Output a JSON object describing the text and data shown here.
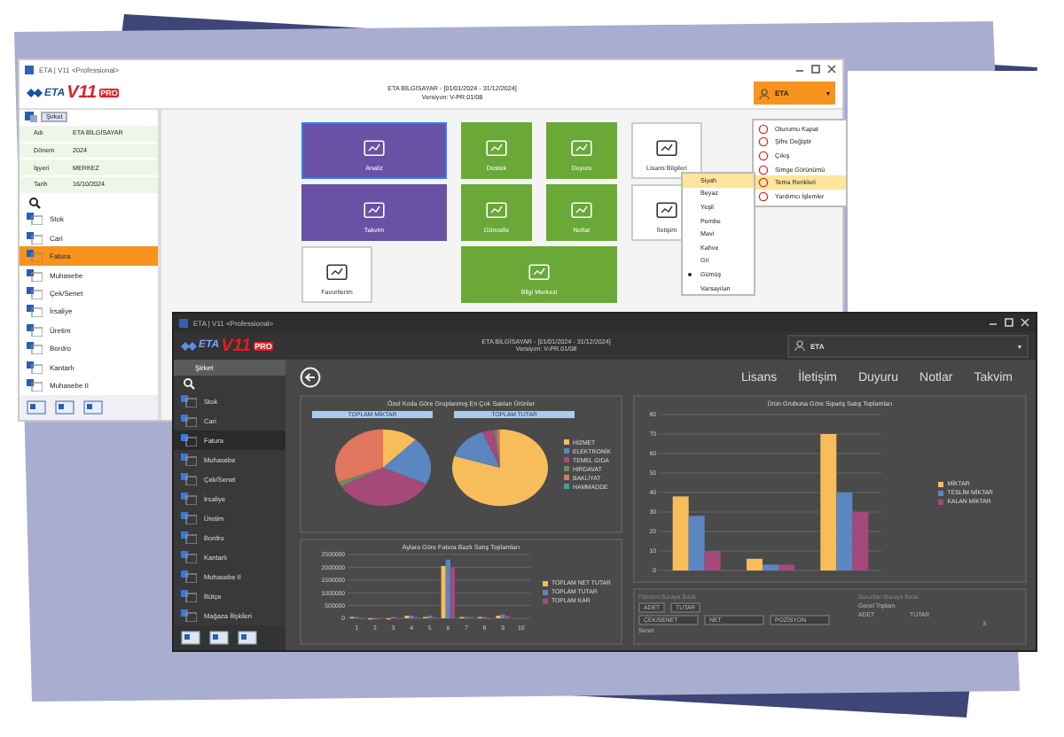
{
  "light_window": {
    "title": "ETA | V11 <Professional>",
    "logo": {
      "brand": "ETA",
      "version": "V11",
      "badge": "PRO"
    },
    "header": {
      "company": "ETA BİLGİSAYAR - [01/01/2024 - 31/12/2024]",
      "version": "Versiyon: V-PR.01/08"
    },
    "user": {
      "name": "ETA",
      "caret": "▾"
    },
    "company_node": "Şirket",
    "fields": [
      {
        "label": "Adı",
        "value": "ETA BİLGİSAYAR"
      },
      {
        "label": "Dönem",
        "value": "2024"
      },
      {
        "label": "İşyeri",
        "value": "MERKEZ"
      },
      {
        "label": "Tarih",
        "value": "16/10/2024"
      }
    ],
    "modules": [
      {
        "label": "Stok",
        "selected": false
      },
      {
        "label": "Cari",
        "selected": false
      },
      {
        "label": "Fatura",
        "selected": true
      },
      {
        "label": "Muhasebe",
        "selected": false
      },
      {
        "label": "Çek/Senet",
        "selected": false
      },
      {
        "label": "İrsaliye",
        "selected": false
      },
      {
        "label": "Üretim",
        "selected": false
      },
      {
        "label": "Bordro",
        "selected": false
      },
      {
        "label": "Kantarlı",
        "selected": false
      },
      {
        "label": "Muhasebe II",
        "selected": false
      }
    ],
    "tiles": [
      {
        "label": "Analiz",
        "kind": "primary",
        "selected": true
      },
      {
        "label": "Destek",
        "kind": "secondary",
        "selected": false
      },
      {
        "label": "Duyuru",
        "kind": "secondary",
        "selected": false
      },
      {
        "label": "Lisans Bilgileri",
        "kind": "plain",
        "selected": false
      },
      {
        "label": "Takvim",
        "kind": "primary",
        "selected": false
      },
      {
        "label": "Güncelle",
        "kind": "secondary",
        "selected": false
      },
      {
        "label": "Notlar",
        "kind": "secondary",
        "selected": false
      },
      {
        "label": "İletişim",
        "kind": "plain",
        "selected": false
      },
      {
        "label": "Favorilerim",
        "kind": "plain",
        "selected": false
      },
      {
        "label": "Bilgi Merkezi",
        "kind": "secondary",
        "selected": false
      }
    ],
    "user_menu": [
      {
        "label": "Oturumu Kapat",
        "selected": false
      },
      {
        "label": "Şifre Değiştir",
        "selected": false
      },
      {
        "label": "Çıkış",
        "selected": false
      },
      {
        "label": "Simge Görünümü",
        "selected": false
      },
      {
        "label": "Tema Renkleri",
        "selected": true
      },
      {
        "label": "Yardımcı İşlemler",
        "selected": false
      }
    ],
    "theme_menu": [
      {
        "label": "Siyah",
        "selected": true,
        "checked": false
      },
      {
        "label": "Beyaz",
        "selected": false,
        "checked": false
      },
      {
        "label": "Yeşil",
        "selected": false,
        "checked": false
      },
      {
        "label": "Pembe",
        "selected": false,
        "checked": false
      },
      {
        "label": "Mavi",
        "selected": false,
        "checked": false
      },
      {
        "label": "Kahve",
        "selected": false,
        "checked": false
      },
      {
        "label": "Gri",
        "selected": false,
        "checked": false
      },
      {
        "label": "Gümüş",
        "selected": false,
        "checked": true
      },
      {
        "label": "Varsayılan",
        "selected": false,
        "checked": false
      }
    ]
  },
  "dark_window": {
    "title": "ETA | V11 <Professional>",
    "logo": {
      "brand": "ETA",
      "version": "V11",
      "badge": "PRO"
    },
    "header": {
      "company": "ETA BİLGİSAYAR - [01/01/2024 - 31/12/2024]",
      "version": "Versiyon: V-PR.01/08"
    },
    "user": {
      "name": "ETA",
      "caret": "▾"
    },
    "company_node": "Şirket",
    "modules": [
      {
        "label": "Stok",
        "selected": false
      },
      {
        "label": "Cari",
        "selected": false
      },
      {
        "label": "Fatura",
        "selected": true
      },
      {
        "label": "Muhasebe",
        "selected": false
      },
      {
        "label": "Çek/Senet",
        "selected": false
      },
      {
        "label": "İrsaliye",
        "selected": false
      },
      {
        "label": "Üretim",
        "selected": false
      },
      {
        "label": "Bordro",
        "selected": false
      },
      {
        "label": "Kantarlı",
        "selected": false
      },
      {
        "label": "Muhasebe II",
        "selected": false
      },
      {
        "label": "Bütçe",
        "selected": false
      },
      {
        "label": "Mağaza İlişkileri",
        "selected": false
      }
    ],
    "nav": [
      "Lisans",
      "İletişim",
      "Duyuru",
      "Notlar",
      "Takvim"
    ],
    "pie_panel": {
      "title": "Özel Koda Göre Gruplanmış En Çok Satılan Ürünler",
      "tabs": [
        "TOPLAM MİKTAR",
        "TOPLAM TUTAR"
      ],
      "legend": [
        {
          "label": "HİZMET",
          "color": "#f7bd5a"
        },
        {
          "label": "ELEKTRONİK",
          "color": "#5a86c2"
        },
        {
          "label": "TEMEL GIDA",
          "color": "#a4497a"
        },
        {
          "label": "HIRDAVAT",
          "color": "#6f8a5c"
        },
        {
          "label": "BAKLİYAT",
          "color": "#e0775e"
        },
        {
          "label": "HAMMADDE",
          "color": "#3aa59a"
        }
      ]
    },
    "order_chart": {
      "chart_data": {
        "type": "bar",
        "title": "Ürün Grubuna Göre Sipariş Satış Toplamları",
        "grid": true,
        "legend": "right",
        "ylim": [
          0,
          80
        ],
        "yticks": [
          0,
          10,
          20,
          30,
          40,
          50,
          60,
          70,
          80
        ],
        "series": [
          {
            "name": "MİKTAR",
            "color": "#f7bd5a",
            "values": [
              38,
              6,
              70
            ]
          },
          {
            "name": "TESLİM MİKTAR",
            "color": "#5a86c2",
            "values": [
              28,
              3,
              40
            ]
          },
          {
            "name": "KALAN MİKTAR",
            "color": "#a4497a",
            "values": [
              10,
              3,
              30
            ]
          }
        ]
      }
    },
    "month_chart": {
      "chart_data": {
        "type": "bar",
        "title": "Aylara Göre Fatura Bazlı Satış Toplamları",
        "grid": true,
        "legend": "right",
        "categories": [
          "1",
          "2",
          "3",
          "4",
          "5",
          "6",
          "7",
          "8",
          "9",
          "10"
        ],
        "ylim": [
          0,
          2500000
        ],
        "yticks": [
          0,
          500000,
          1000000,
          1500000,
          2000000,
          2500000
        ],
        "series": [
          {
            "name": "TOPLAM NET TUTAR",
            "color": "#f7bd5a",
            "values": [
              50000,
              0,
              0,
              100000,
              50000,
              2050000,
              50000,
              50000,
              100000,
              null
            ]
          },
          {
            "name": "TOPLAM TUTAR",
            "color": "#5a86c2",
            "values": [
              50000,
              0,
              50000,
              100000,
              100000,
              2300000,
              50000,
              50000,
              150000,
              null
            ]
          },
          {
            "name": "TOPLAM KAR",
            "color": "#a4497a",
            "values": [
              0,
              0,
              0,
              50000,
              50000,
              2000000,
              50000,
              0,
              100000,
              null
            ]
          }
        ]
      }
    },
    "pivot": {
      "filter_hint": "Filtreleri Buraya Bırak",
      "data_fields": [
        "ADET",
        "TUTAR"
      ],
      "row_fields": [
        "ÇEK/SENET",
        "NET",
        "POZİSYON"
      ],
      "column_hint": "Sütunları Buraya Bırak",
      "grand_total": "Genel Toplam",
      "columns": [
        "ADET",
        "TUTAR"
      ],
      "rows": [
        {
          "label": "Senet",
          "adet": "3"
        }
      ]
    }
  }
}
